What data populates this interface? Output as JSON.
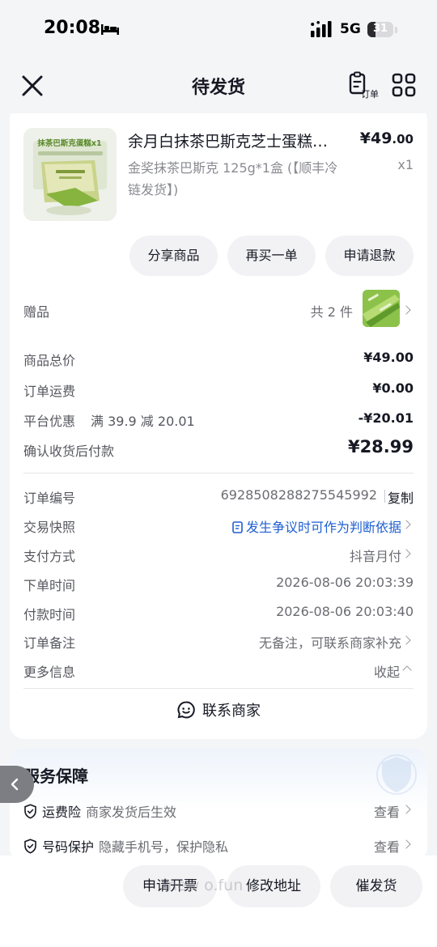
{
  "status_bar": {
    "time": "20:08",
    "network": "5G",
    "battery": "31",
    "icons": [
      "bed-icon",
      "signal-icon",
      "battery-icon"
    ]
  },
  "nav": {
    "title": "待发货",
    "orders_label": "订单",
    "icons": [
      "close-icon",
      "orders-icon",
      "grid-icon"
    ]
  },
  "product": {
    "image_text": "抹茶巴斯克蛋糕x1",
    "name": "余月白抹茶巴斯克芝士蛋糕…",
    "spec": "金奖抹茶巴斯克 125g*1盒 (【顺丰冷链发货】)",
    "price_main": "¥49",
    "price_dec": ".00",
    "qty": "x1"
  },
  "actions": {
    "share": "分享商品",
    "rebuy": "再买一单",
    "refund": "申请退款"
  },
  "gift": {
    "label": "赠品",
    "count": "共 2 件"
  },
  "pricing": {
    "total_label": "商品总价",
    "total_value": "¥49.00",
    "shipping_label": "订单运费",
    "shipping_value": "¥0.00",
    "discount_label": "平台优惠",
    "discount_note": "满 39.9 减 20.01",
    "discount_value": "-¥20.01",
    "pay_label": "确认收货后付款",
    "pay_value": "¥28.99"
  },
  "order_info": {
    "id_label": "订单编号",
    "id_value": "6928508288275545992",
    "copy": "复制",
    "snapshot_label": "交易快照",
    "snapshot_value": "发生争议时可作为判断依据",
    "payment_label": "支付方式",
    "payment_value": "抖音月付",
    "order_time_label": "下单时间",
    "order_time_value": "2026-08-06 20:03:39",
    "pay_time_label": "付款时间",
    "pay_time_value": "2026-08-06 20:03:40",
    "remark_label": "订单备注",
    "remark_value": "无备注，可联系商家补充",
    "more_label": "更多信息",
    "collapse": "收起"
  },
  "contact": "联系商家",
  "service": {
    "title": "服务保障",
    "items": [
      {
        "name": "运费险",
        "desc": "商家发货后生效",
        "link": "查看"
      },
      {
        "name": "号码保护",
        "desc": "隐藏手机号，保护隐私",
        "link": "查看"
      }
    ]
  },
  "bottom": {
    "invoice": "申请开票",
    "address": "修改地址",
    "urge": "催发货",
    "watermark": "-new     o.fun"
  },
  "colors": {
    "link_blue": "#1f5fd1",
    "background": "#f4f5f7"
  }
}
